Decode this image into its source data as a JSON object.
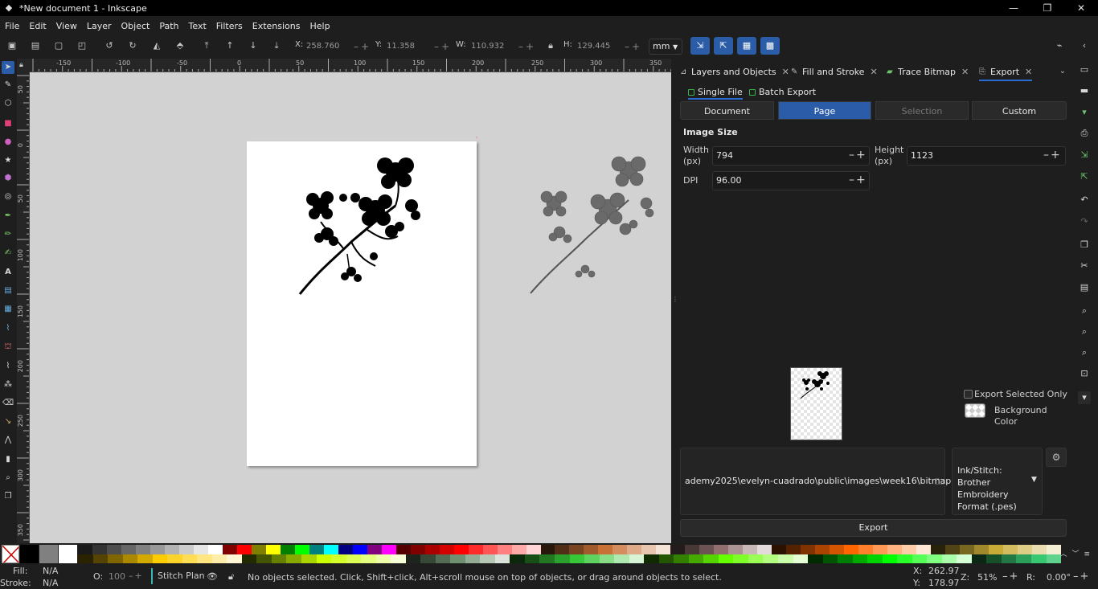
{
  "window": {
    "title": "*New document 1 - Inkscape",
    "minimize": "—",
    "maximize": "❐",
    "close": "✕"
  },
  "menu": [
    "File",
    "Edit",
    "View",
    "Layer",
    "Object",
    "Path",
    "Text",
    "Filters",
    "Extensions",
    "Help"
  ],
  "toolcontrols": {
    "x_label": "X:",
    "x_value": "258.760",
    "y_label": "Y:",
    "y_value": "11.358",
    "w_label": "W:",
    "w_value": "110.932",
    "h_label": "H:",
    "h_value": "129.445",
    "unit": "mm",
    "pm": "–+"
  },
  "rulers": {
    "h_labels": [
      "-150",
      "-100",
      "-50",
      "0",
      "50",
      "100",
      "150",
      "200",
      "250",
      "300",
      "350"
    ],
    "v_labels": [
      "50",
      "0",
      "50",
      "100",
      "150",
      "200",
      "250",
      "300",
      "350"
    ]
  },
  "dock": {
    "tabs": [
      {
        "label": "Layers and Objects",
        "icon": "layers-icon"
      },
      {
        "label": "Fill and Stroke",
        "icon": "fill-stroke-icon"
      },
      {
        "label": "Trace Bitmap",
        "icon": "trace-bitmap-icon"
      },
      {
        "label": "Export",
        "icon": "export-icon"
      }
    ],
    "close_glyph": "✕",
    "export": {
      "mode_single": "Single File",
      "mode_batch": "Batch Export",
      "area_tabs": [
        "Document",
        "Page",
        "Selection",
        "Custom"
      ],
      "active_area": "Page",
      "image_size_title": "Image Size",
      "width_label": "Width\n(px)",
      "width_label_line1": "Width",
      "width_label_line2": "(px)",
      "width_value": "794",
      "height_label_line1": "Height",
      "height_label_line2": "(px)",
      "height_value": "1123",
      "dpi_label": "DPI",
      "dpi_value": "96.00",
      "pm": "–+",
      "export_selected_only": "Export Selected Only",
      "background_color": "Background Color",
      "filename": "ademy2025\\evelyn-cuadrado\\public\\images\\week16\\bitmap.pes",
      "format_line1": "Ink/Stitch: Brother",
      "format_line2": "Embroidery",
      "format_line3": "Format (.pes)",
      "export_button": "Export"
    }
  },
  "statusbar": {
    "fill_label": "Fill:",
    "fill_value": "N/A",
    "stroke_label": "Stroke:",
    "stroke_value": "N/A",
    "opacity_label": "O:",
    "opacity_value": "100",
    "layer": "Stitch Plan",
    "message": "No objects selected. Click, Shift+click, Alt+scroll mouse on top of objects, or drag around objects to select.",
    "cursor_x_label": "X:",
    "cursor_x": "262.97",
    "cursor_y_label": "Y:",
    "cursor_y": "178.97",
    "zoom_label": "Z:",
    "zoom": "51%",
    "rotation_label": "R:",
    "rotation": "0.00°",
    "pm": "–+"
  },
  "colors": {
    "accent": "#2a5ca8",
    "tab_underline": "#2a6bd1",
    "background": "#1e1e1e",
    "canvas": "#d2d2d2"
  },
  "palette_top": [
    "#1a1a1a",
    "#333333",
    "#4d4d4d",
    "#666666",
    "#808080",
    "#999999",
    "#b3b3b3",
    "#cccccc",
    "#e6e6e6",
    "#ffffff",
    "#800000",
    "#ff0000",
    "#808000",
    "#ffff00",
    "#008000",
    "#00ff00",
    "#008080",
    "#00ffff",
    "#000080",
    "#0000ff",
    "#800080",
    "#ff00ff",
    "#550000",
    "#800000",
    "#aa0000",
    "#d40000",
    "#ff0000",
    "#ff2a2a",
    "#ff5555",
    "#ff8080",
    "#ffaaaa",
    "#ffd5d5",
    "#28170b",
    "#502d16",
    "#784421",
    "#a05a2c",
    "#c87137",
    "#d38d5f",
    "#deaa87",
    "#e9c6af",
    "#f4e3d7",
    "#241c1c",
    "#483737",
    "#6c5353",
    "#916f6f",
    "#ac9393",
    "#c8b7b7",
    "#e3dbdb",
    "#2b1100",
    "#552200",
    "#803300",
    "#aa4400",
    "#d45500",
    "#ff6600",
    "#ff7f2a",
    "#ff9955",
    "#ffb380",
    "#ffccaa",
    "#ffe6d5",
    "#28220b",
    "#504416",
    "#786721",
    "#a0892c",
    "#c8ab37",
    "#d3bc5f",
    "#decd87",
    "#e9ddaf",
    "#f4eed7"
  ],
  "palette_bottom": [
    "#2b2200",
    "#554400",
    "#806600",
    "#aa8800",
    "#d4aa00",
    "#ffcc00",
    "#ffd42a",
    "#ffdd55",
    "#ffe680",
    "#ffeeaa",
    "#fff6d5",
    "#222b00",
    "#445500",
    "#668000",
    "#88aa00",
    "#aad400",
    "#ccff00",
    "#d4ff2a",
    "#ddff55",
    "#e5ff80",
    "#eeffaa",
    "#f6ffd5",
    "#1c241c",
    "#374837",
    "#536c53",
    "#6f916f",
    "#93ac93",
    "#b7c8b7",
    "#dbe3db",
    "#0b280b",
    "#165016",
    "#217821",
    "#2ca02c",
    "#37c837",
    "#5fd35f",
    "#87de87",
    "#afe9af",
    "#d7f4d7",
    "#112b00",
    "#225500",
    "#338000",
    "#44aa00",
    "#55d400",
    "#66ff00",
    "#7fff2a",
    "#99ff55",
    "#b3ff80",
    "#ccffaa",
    "#e5ffd5",
    "#002b00",
    "#005500",
    "#008000",
    "#00aa00",
    "#00d400",
    "#00ff00",
    "#2aff2a",
    "#55ff55",
    "#80ff80",
    "#aaffaa",
    "#d5ffd5",
    "#0b2816",
    "#165028",
    "#217844",
    "#2ca05a",
    "#37c871",
    "#5fd38d"
  ],
  "palette_ctrls": "︿﹀≡"
}
